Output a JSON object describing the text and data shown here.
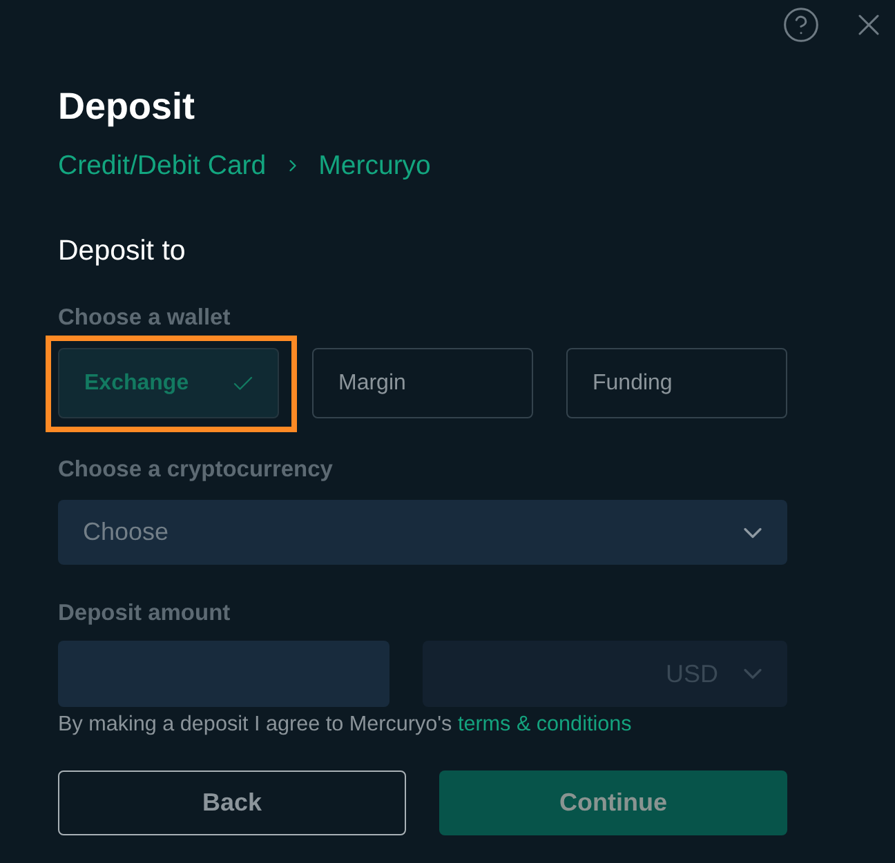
{
  "window": {
    "title": "Deposit"
  },
  "breadcrumb": [
    {
      "label": "Credit/Debit Card"
    },
    {
      "label": "Mercuryo"
    }
  ],
  "section_title": "Deposit to",
  "wallet": {
    "label": "Choose a wallet",
    "options": [
      {
        "label": "Exchange",
        "selected": true,
        "highlighted": true
      },
      {
        "label": "Margin",
        "selected": false,
        "highlighted": false
      },
      {
        "label": "Funding",
        "selected": false,
        "highlighted": false
      }
    ]
  },
  "cryptocurrency": {
    "label": "Choose a cryptocurrency",
    "placeholder": "Choose"
  },
  "amount": {
    "label": "Deposit amount",
    "currency": {
      "value": "USD",
      "disabled": true
    }
  },
  "terms": {
    "text": "By making a deposit I agree to Mercuryo's ",
    "link": "terms & conditions"
  },
  "buttons": [
    {
      "label": "Back",
      "kind": "secondary"
    },
    {
      "label": "Continue",
      "kind": "primary",
      "disabled": true
    }
  ]
}
